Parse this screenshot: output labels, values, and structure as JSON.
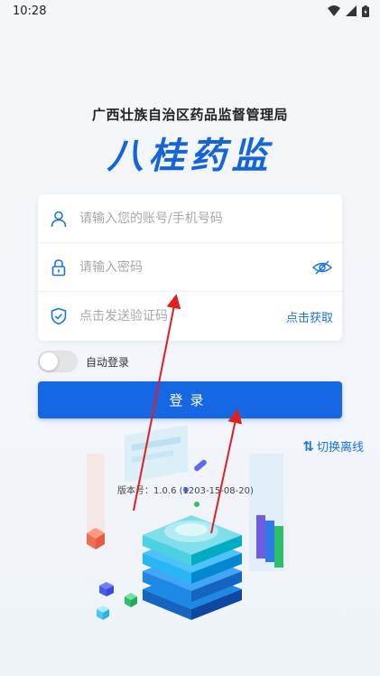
{
  "status_bar": {
    "time": "10:28"
  },
  "header": {
    "agency": "广西壮族自治区药品监督管理局",
    "app_name": "八桂药监"
  },
  "form": {
    "account_placeholder": "请输入您的账号/手机号码",
    "password_placeholder": "请输入密码",
    "code_placeholder": "点击发送验证码",
    "get_code_label": "点击获取"
  },
  "auto_login": {
    "label": "自动登录",
    "enabled": false
  },
  "login_button": {
    "label": "登录"
  },
  "offline": {
    "label": "切换离线",
    "icon": "swap-vertical-icon"
  },
  "version": {
    "label": "版本号：",
    "value": "1.0.6 (1203-15-08-20)"
  },
  "colors": {
    "primary": "#1567e3",
    "link": "#1a73e8",
    "arrow": "#e02020"
  }
}
